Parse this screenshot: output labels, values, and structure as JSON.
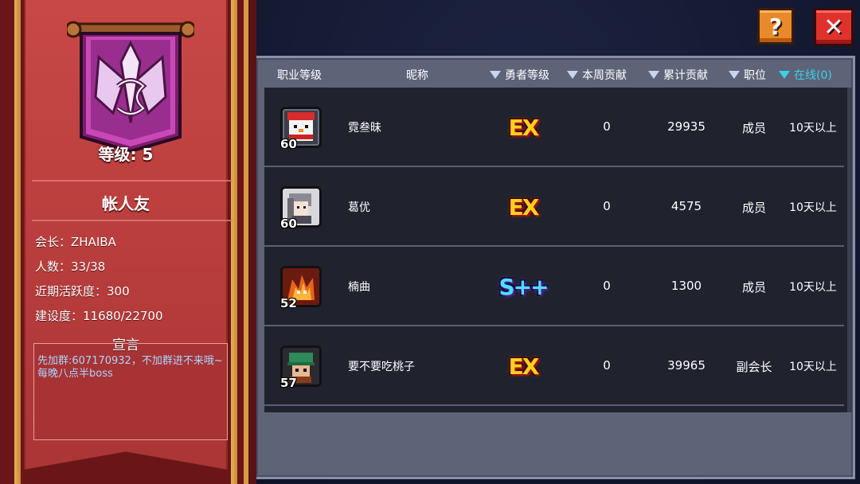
{
  "guild": {
    "level_text": "等级: 5",
    "name": "帐人友",
    "leader": "会长：ZHAIBA",
    "members": "人数：33/38",
    "activity": "近期活跃度：300",
    "construction": "建设度：11680/22700",
    "declaration_title": "宣言",
    "declaration": "先加群:607170932，不加群进不来哦~ 每晚八点半boss"
  },
  "buttons": {
    "help": "?",
    "close": "✕"
  },
  "table": {
    "headers": {
      "class_level": "职业等级",
      "nickname": "昵称",
      "hero_level": "勇者等级",
      "week_contribution": "本周贡献",
      "total_contribution": "累计贡献",
      "position": "职位",
      "online": "在线(0)"
    },
    "rows": [
      {
        "level": "60",
        "avatar": "snowman-avatar",
        "name": "霓叁昧",
        "rank": "EX",
        "rank_color": "#ffd21c",
        "week": "0",
        "total": "29935",
        "role": "成员",
        "online": "10天以上"
      },
      {
        "level": "60",
        "avatar": "silver-hair-avatar",
        "name": "葛优",
        "rank": "EX",
        "rank_color": "#ffd21c",
        "week": "0",
        "total": "4575",
        "role": "成员",
        "online": "10天以上"
      },
      {
        "level": "52",
        "avatar": "flame-beast-avatar",
        "name": "楠曲",
        "rank": "S++",
        "rank_color": "#4ae0ff",
        "week": "0",
        "total": "1300",
        "role": "成员",
        "online": "10天以上"
      },
      {
        "level": "57",
        "avatar": "helmet-knight-avatar",
        "name": "要不要吃桃子",
        "rank": "EX",
        "rank_color": "#ffd21c",
        "week": "0",
        "total": "39965",
        "role": "副会长",
        "online": "10天以上"
      }
    ]
  }
}
